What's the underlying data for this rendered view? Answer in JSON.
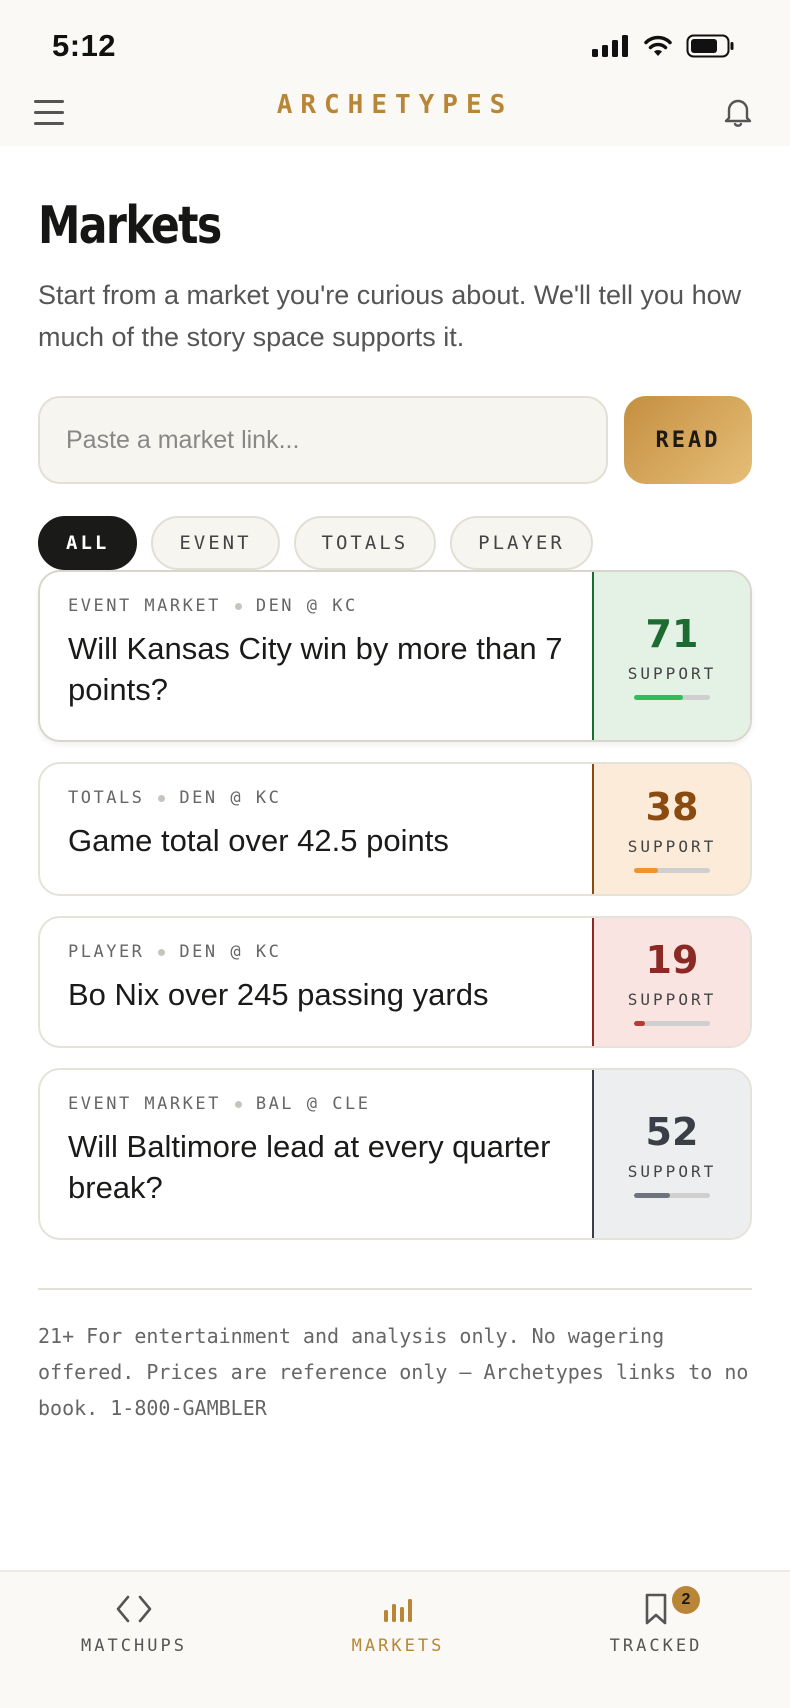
{
  "status_bar": {
    "time": "5:12"
  },
  "header": {
    "brand": "ARCHETYPES"
  },
  "page": {
    "title": "Markets",
    "subtitle": "Start from a market you're curious about. We'll tell you how much of the story space supports it."
  },
  "search": {
    "placeholder": "Paste a market link...",
    "button_label": "READ"
  },
  "filters": [
    {
      "label": "ALL",
      "active": true
    },
    {
      "label": "EVENT",
      "active": false
    },
    {
      "label": "TOTALS",
      "active": false
    },
    {
      "label": "PLAYER",
      "active": false
    }
  ],
  "markets": [
    {
      "type": "EVENT MARKET",
      "matchup": "DEN @ KC",
      "question": "Will Kansas City win by more than 7 points?",
      "support": 71,
      "support_label": "SUPPORT",
      "fill_fraction": 0.65,
      "panel_bg": "#e4f1e5",
      "accent": "#1e6b32",
      "bar_color": "#2fbf5a"
    },
    {
      "type": "TOTALS",
      "matchup": "DEN @ KC",
      "question": "Game total over 42.5 points",
      "support": 38,
      "support_label": "SUPPORT",
      "fill_fraction": 0.32,
      "panel_bg": "#fcebd9",
      "accent": "#8a4a10",
      "bar_color": "#f0932a"
    },
    {
      "type": "PLAYER",
      "matchup": "DEN @ KC",
      "question": "Bo Nix over 245 passing yards",
      "support": 19,
      "support_label": "SUPPORT",
      "fill_fraction": 0.15,
      "panel_bg": "#f9e4e2",
      "accent": "#8b2a24",
      "bar_color": "#b93a31"
    },
    {
      "type": "EVENT MARKET",
      "matchup": "BAL @ CLE",
      "question": "Will Baltimore lead at every quarter break?",
      "support": 52,
      "support_label": "SUPPORT",
      "fill_fraction": 0.48,
      "panel_bg": "#edeef0",
      "accent": "#3a3f47",
      "bar_color": "#6e747e"
    }
  ],
  "disclaimer": "21+ For entertainment and analysis only. No wagering offered. Prices are reference only — Archetypes links to no book. 1-800-GAMBLER",
  "tabs": [
    {
      "label": "MATCHUPS",
      "icon": "code-brackets-icon",
      "active": false
    },
    {
      "label": "MARKETS",
      "icon": "bar-chart-icon",
      "active": true
    },
    {
      "label": "TRACKED",
      "icon": "bookmark-icon",
      "active": false,
      "badge": "2"
    }
  ],
  "colors": {
    "brand": "#b98637",
    "chip_active": "#1a1a18"
  }
}
